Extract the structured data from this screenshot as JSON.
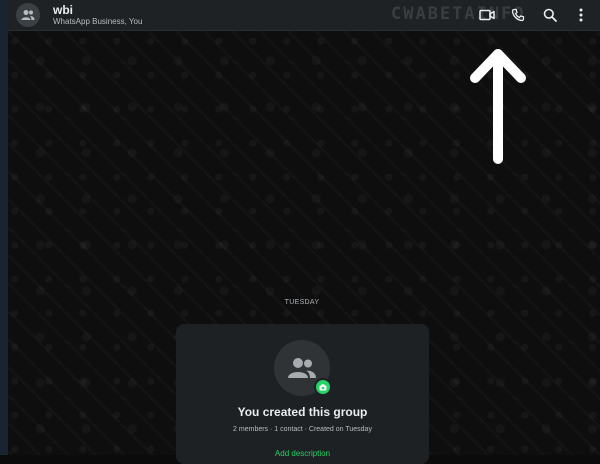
{
  "header": {
    "chat_name": "wbi",
    "chat_subtitle": "WhatsApp Business, You",
    "watermark": "CWABETAINFO",
    "icons": [
      "group-avatar-icon",
      "video-call-icon",
      "voice-call-icon",
      "search-icon",
      "more-options-icon"
    ]
  },
  "chat": {
    "date_chip": "TUESDAY",
    "system_card": {
      "title": "You created this group",
      "meta": "2 members · 1 contact · Created on Tuesday",
      "action": "Add description"
    }
  },
  "colors": {
    "header_bg": "#1f2225",
    "chat_bg": "#0e0e0e",
    "card_bg": "#1e2124",
    "accent": "#25d366"
  }
}
